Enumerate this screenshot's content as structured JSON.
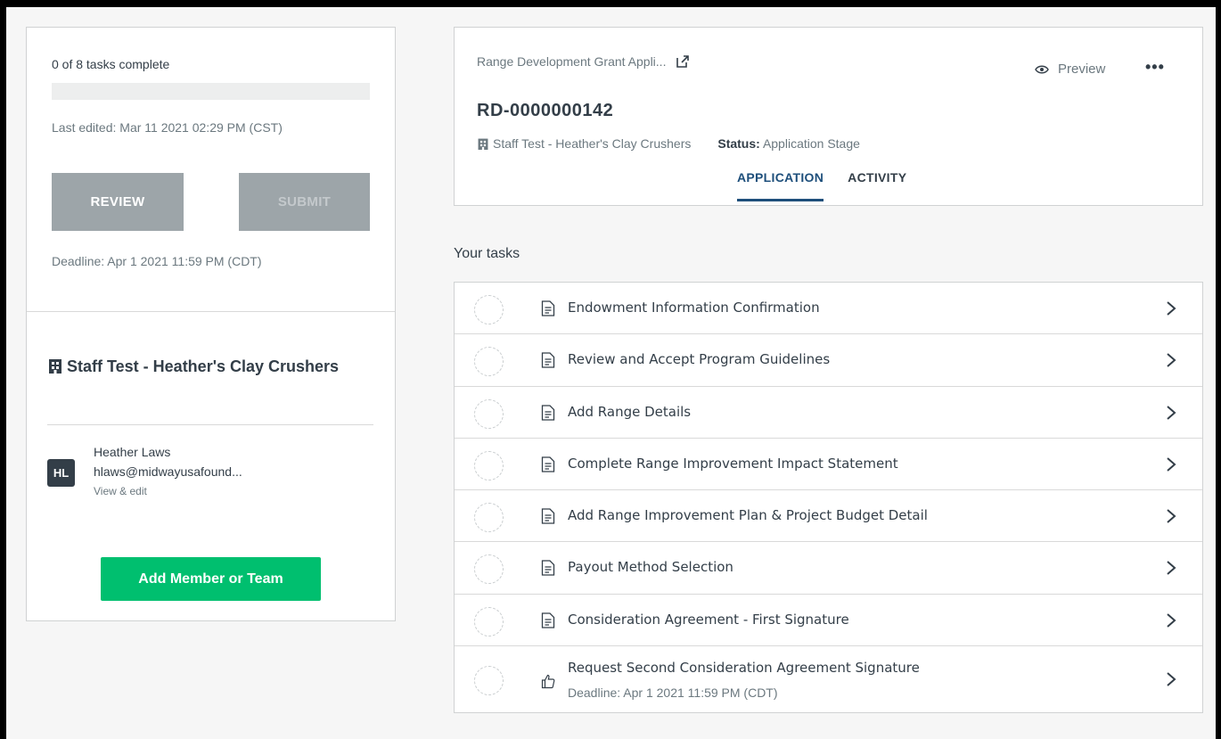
{
  "summary": {
    "progress_text": "0 of 8 tasks complete",
    "progress_fraction": 0,
    "last_edited": "Last edited: Mar 11 2021 02:29 PM (CST)",
    "review_label": "REVIEW",
    "submit_label": "SUBMIT",
    "deadline": "Deadline: Apr 1 2021 11:59 PM (CDT)"
  },
  "organization": {
    "name": "Staff Test - Heather's Clay Crushers",
    "member": {
      "initials": "HL",
      "name": "Heather Laws",
      "email": "hlaws@midwayusafound...",
      "edit_label": "View & edit"
    },
    "add_member_label": "Add Member or Team"
  },
  "header": {
    "app_name": "Range Development Grant Appli...",
    "preview_label": "Preview",
    "more_label": "•••",
    "app_id": "RD-0000000142",
    "org_name": "Staff Test - Heather's Clay Crushers",
    "status_label": "Status:",
    "status_value": "Application Stage",
    "tabs": [
      "APPLICATION",
      "ACTIVITY"
    ]
  },
  "tasks": {
    "heading": "Your tasks",
    "items": [
      {
        "title": "Endowment Information Confirmation",
        "icon": "document-icon"
      },
      {
        "title": "Review and Accept Program Guidelines",
        "icon": "document-icon"
      },
      {
        "title": "Add Range Details",
        "icon": "document-icon"
      },
      {
        "title": "Complete Range Improvement Impact Statement",
        "icon": "document-icon"
      },
      {
        "title": "Add Range Improvement Plan & Project Budget Detail",
        "icon": "document-icon"
      },
      {
        "title": "Payout Method Selection",
        "icon": "document-icon"
      },
      {
        "title": "Consideration Agreement - First Signature",
        "icon": "document-icon"
      },
      {
        "title": "Request Second Consideration Agreement Signature",
        "icon": "thumbs-up-icon",
        "deadline": "Deadline: Apr 1 2021 11:59 PM (CDT)"
      }
    ]
  },
  "colors": {
    "accent_green": "#00bf6f",
    "tab_active": "#1e4f7b",
    "disabled_button": "#9da5a9"
  }
}
